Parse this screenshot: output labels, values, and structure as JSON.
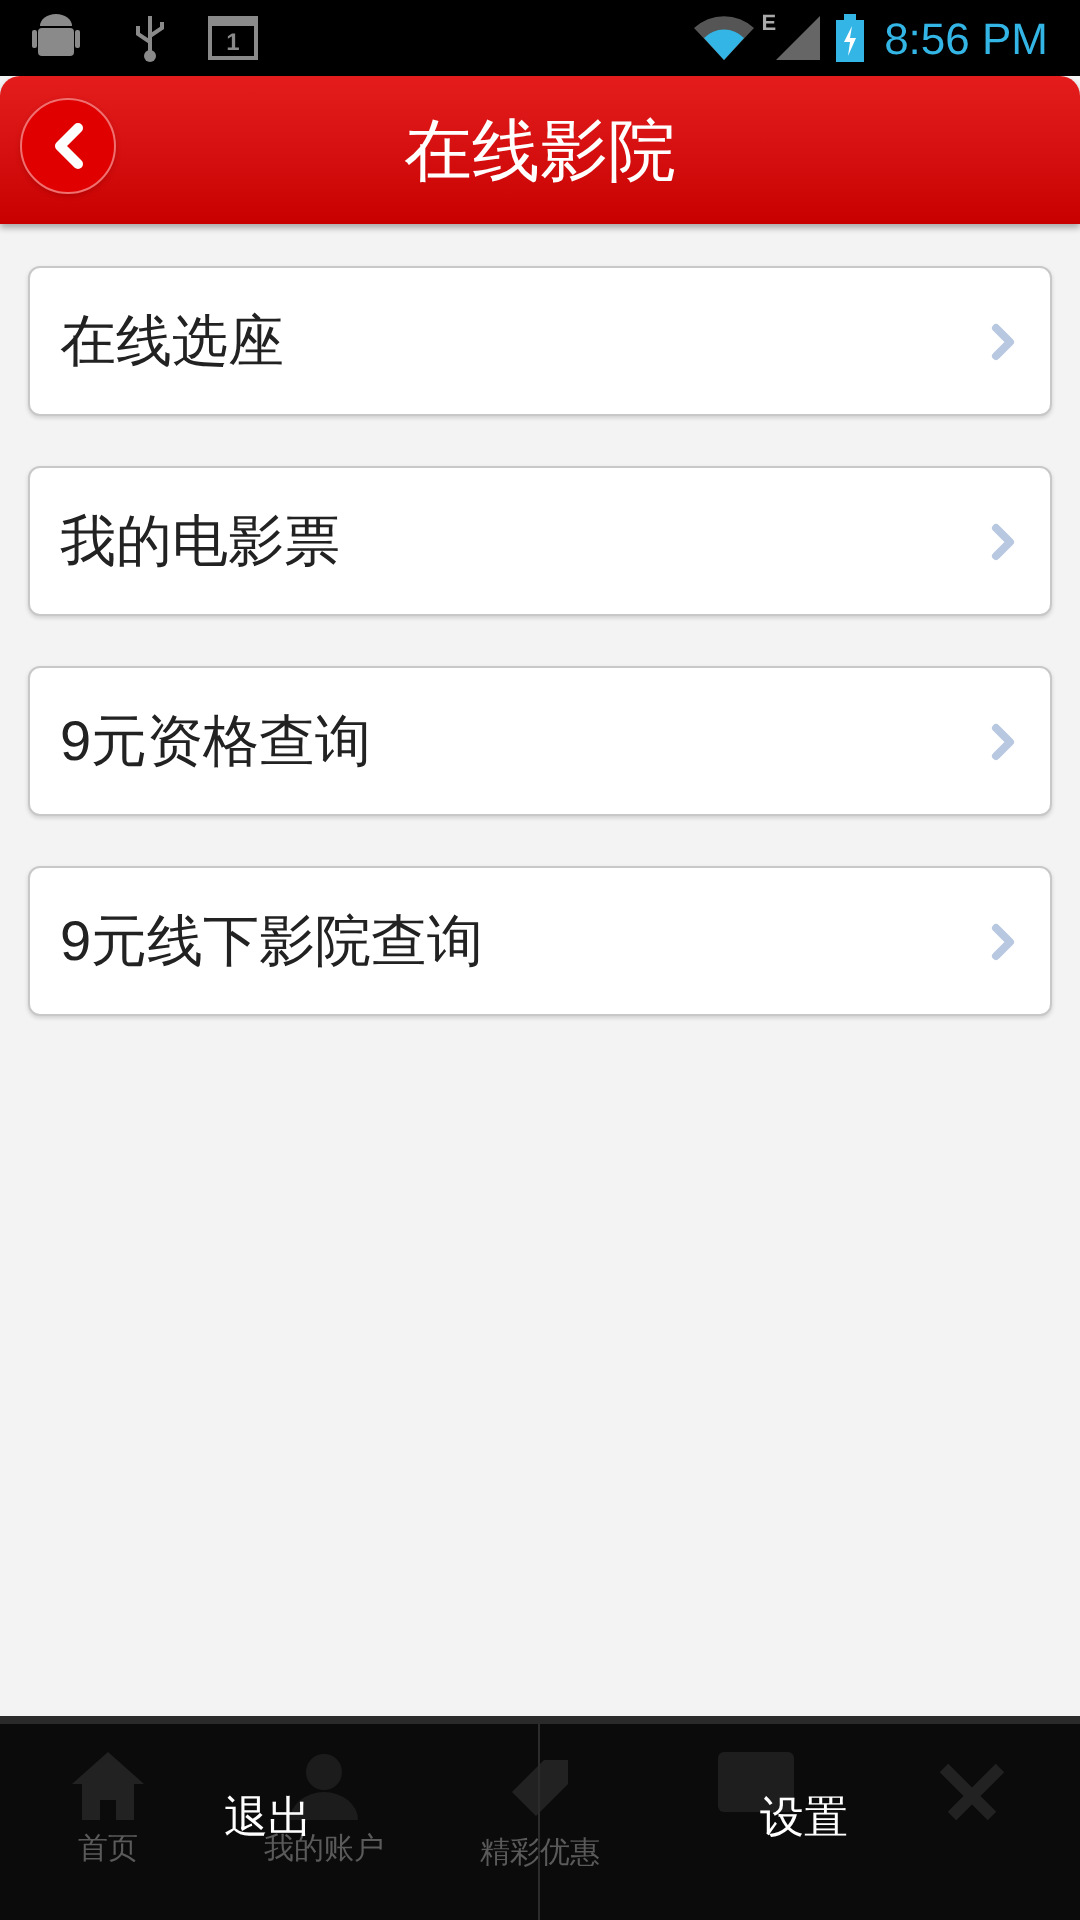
{
  "status_bar": {
    "time": "8:56 PM",
    "network": "E",
    "notification_count": "1"
  },
  "header": {
    "title": "在线影院"
  },
  "menu_items": [
    {
      "label": "在线选座"
    },
    {
      "label": "我的电影票"
    },
    {
      "label": "9元资格查询"
    },
    {
      "label": "9元线下影院查询"
    }
  ],
  "tab_bar": [
    {
      "label": "首页"
    },
    {
      "label": "我的账户"
    },
    {
      "label": "精彩优惠"
    }
  ],
  "options_menu": [
    {
      "label": "退出"
    },
    {
      "label": "设置"
    }
  ]
}
